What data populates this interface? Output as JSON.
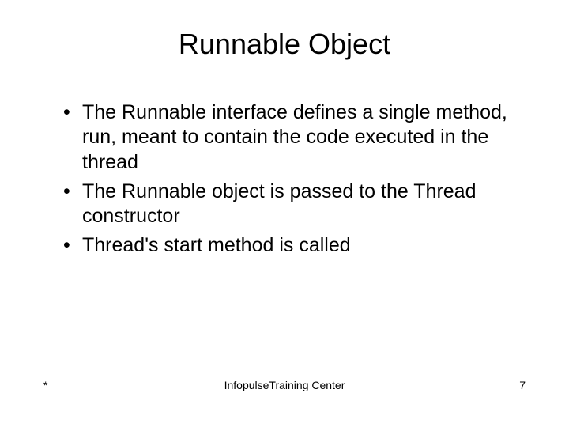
{
  "title": "Runnable Object",
  "bullets": [
    "The Runnable interface defines a single method, run, meant to contain the code executed in the thread",
    "The Runnable object is passed to the Thread constructor",
    "Thread's start method is called"
  ],
  "footer": {
    "left": "*",
    "center": "InfopulseTraining Center",
    "right": "7"
  }
}
